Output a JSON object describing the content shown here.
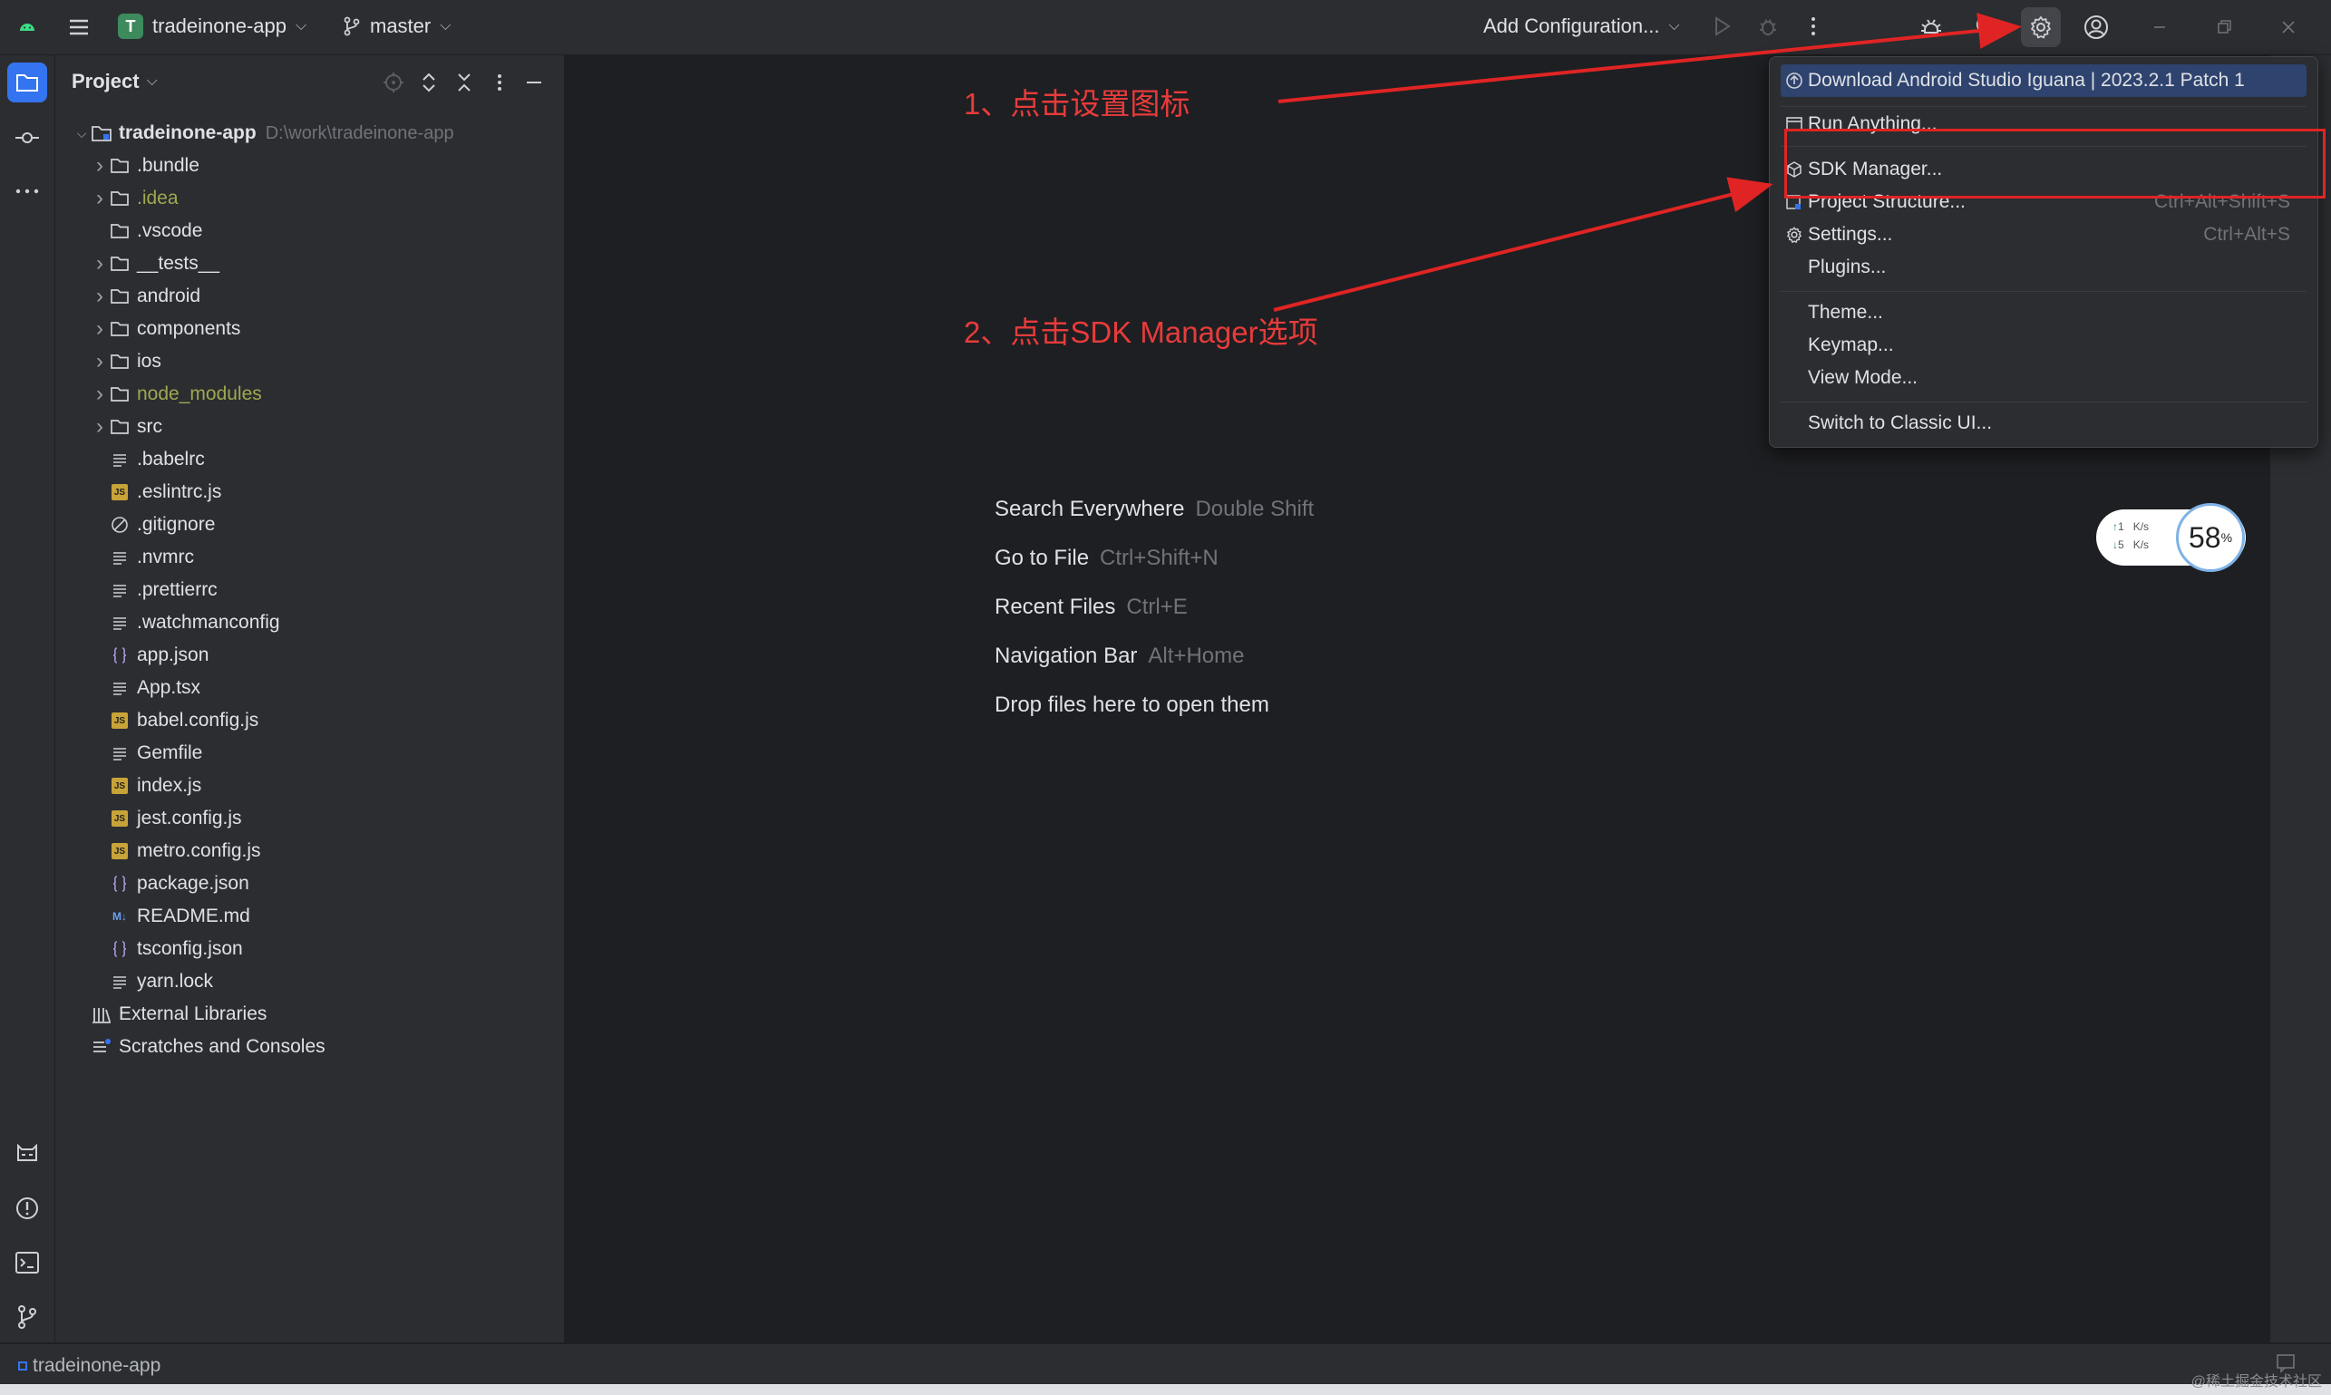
{
  "titlebar": {
    "project_badge": "T",
    "project_name": "tradeinone-app",
    "branch": "master",
    "run_config": "Add Configuration..."
  },
  "project_panel": {
    "title": "Project",
    "root": {
      "name": "tradeinone-app",
      "path": "D:\\work\\tradeinone-app"
    },
    "items": [
      {
        "name": ".bundle",
        "type": "folder",
        "expandable": true
      },
      {
        "name": ".idea",
        "type": "folder",
        "expandable": true,
        "excluded": true
      },
      {
        "name": ".vscode",
        "type": "folder",
        "expandable": false
      },
      {
        "name": "__tests__",
        "type": "folder",
        "expandable": true
      },
      {
        "name": "android",
        "type": "folder",
        "expandable": true
      },
      {
        "name": "components",
        "type": "folder",
        "expandable": true
      },
      {
        "name": "ios",
        "type": "folder",
        "expandable": true
      },
      {
        "name": "node_modules",
        "type": "folder",
        "expandable": true,
        "excluded": true
      },
      {
        "name": "src",
        "type": "folder",
        "expandable": true
      },
      {
        "name": ".babelrc",
        "type": "text"
      },
      {
        "name": ".eslintrc.js",
        "type": "js"
      },
      {
        "name": ".gitignore",
        "type": "ignore"
      },
      {
        "name": ".nvmrc",
        "type": "text"
      },
      {
        "name": ".prettierrc",
        "type": "text"
      },
      {
        "name": ".watchmanconfig",
        "type": "text"
      },
      {
        "name": "app.json",
        "type": "json"
      },
      {
        "name": "App.tsx",
        "type": "text"
      },
      {
        "name": "babel.config.js",
        "type": "js"
      },
      {
        "name": "Gemfile",
        "type": "text"
      },
      {
        "name": "index.js",
        "type": "js"
      },
      {
        "name": "jest.config.js",
        "type": "js"
      },
      {
        "name": "metro.config.js",
        "type": "js"
      },
      {
        "name": "package.json",
        "type": "json"
      },
      {
        "name": "README.md",
        "type": "md"
      },
      {
        "name": "tsconfig.json",
        "type": "json"
      },
      {
        "name": "yarn.lock",
        "type": "text"
      }
    ],
    "external_libraries": "External Libraries",
    "scratches": "Scratches and Consoles"
  },
  "editor_hints": [
    {
      "action": "Search Everywhere",
      "key": "Double Shift"
    },
    {
      "action": "Go to File",
      "key": "Ctrl+Shift+N"
    },
    {
      "action": "Recent Files",
      "key": "Ctrl+E"
    },
    {
      "action": "Navigation Bar",
      "key": "Alt+Home"
    },
    {
      "action": "Drop files here to open them",
      "key": ""
    }
  ],
  "menu": {
    "update": "Download Android Studio Iguana | 2023.2.1 Patch 1",
    "run_anything": "Run Anything...",
    "sdk_manager": "SDK Manager...",
    "project_structure": "Project Structure...",
    "project_structure_key": "Ctrl+Alt+Shift+S",
    "settings": "Settings...",
    "settings_key": "Ctrl+Alt+S",
    "plugins": "Plugins...",
    "theme": "Theme...",
    "keymap": "Keymap...",
    "view_mode": "View Mode...",
    "classic_ui": "Switch to Classic UI..."
  },
  "annotations": {
    "step1": "1、点击设置图标",
    "step2": "2、点击SDK Manager选项"
  },
  "speed_widget": {
    "up": "1",
    "down": "5",
    "unit": "K/s",
    "percent": "58",
    "percent_sign": "%"
  },
  "statusbar": {
    "project": "tradeinone-app"
  },
  "watermark": "@稀土掘金技术社区",
  "colors": {
    "accent": "#3574f0",
    "annotation": "#e83b3b",
    "excluded": "#a0a850"
  }
}
